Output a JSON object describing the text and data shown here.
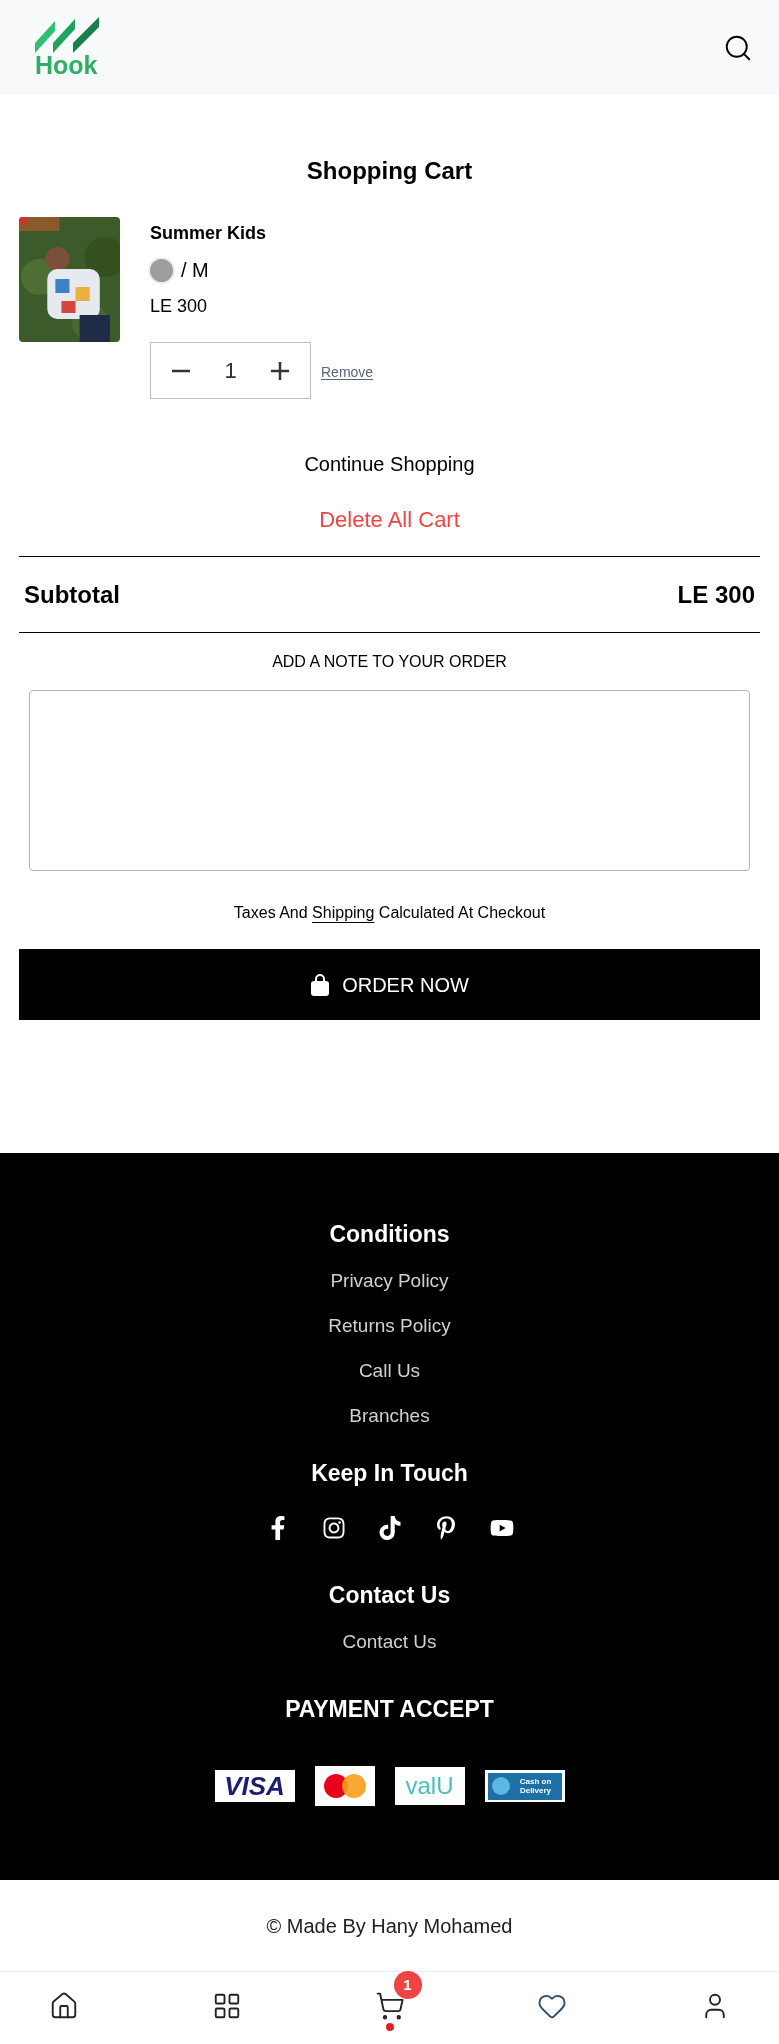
{
  "header": {
    "logo_text": "Hook"
  },
  "cart": {
    "title": "Shopping Cart",
    "items": [
      {
        "kind": "picture",
        "name": "Summer Kids",
        "color": "#9e9e9e",
        "variant": "/ M",
        "price": "LE 300",
        "quantity": "1",
        "remove": "Remove"
      }
    ],
    "continue": "Continue Shopping",
    "delete_all": "Delete All Cart",
    "subtotal": {
      "label": "Subtotal",
      "value": "LE 300"
    },
    "note": {
      "label": "ADD A NOTE TO YOUR ORDER"
    },
    "taxes": {
      "before": "Taxes And",
      "link": "Shipping",
      "after": "Calculated At Checkout"
    },
    "order_button": "ORDER NOW"
  },
  "footer": {
    "sections": [
      {
        "title": "Conditions",
        "links": [
          "Privacy Policy",
          "Returns Policy",
          "Call Us",
          "Branches"
        ]
      },
      {
        "title": "Keep In Touch",
        "kind": "social"
      },
      {
        "title": "Contact Us",
        "links": [
          "Contact Us"
        ]
      }
    ],
    "payment": {
      "title": "PAYMENT ACCEPT",
      "methods": [
        {
          "kind": "visa",
          "label": "VISA"
        },
        {
          "kind": "mastercard"
        },
        {
          "kind": "valu",
          "label": "valU"
        },
        {
          "kind": "cod",
          "label": "Cash on Delivery"
        }
      ]
    }
  },
  "credit": "© Made By Hany Mohamed",
  "bottom_nav": [
    {
      "kind": "home",
      "selected": false
    },
    {
      "kind": "categories",
      "selected": false
    },
    {
      "kind": "cart",
      "selected": true,
      "badge": "1"
    },
    {
      "kind": "wishlist",
      "selected": false
    },
    {
      "kind": "account",
      "selected": false
    }
  ]
}
